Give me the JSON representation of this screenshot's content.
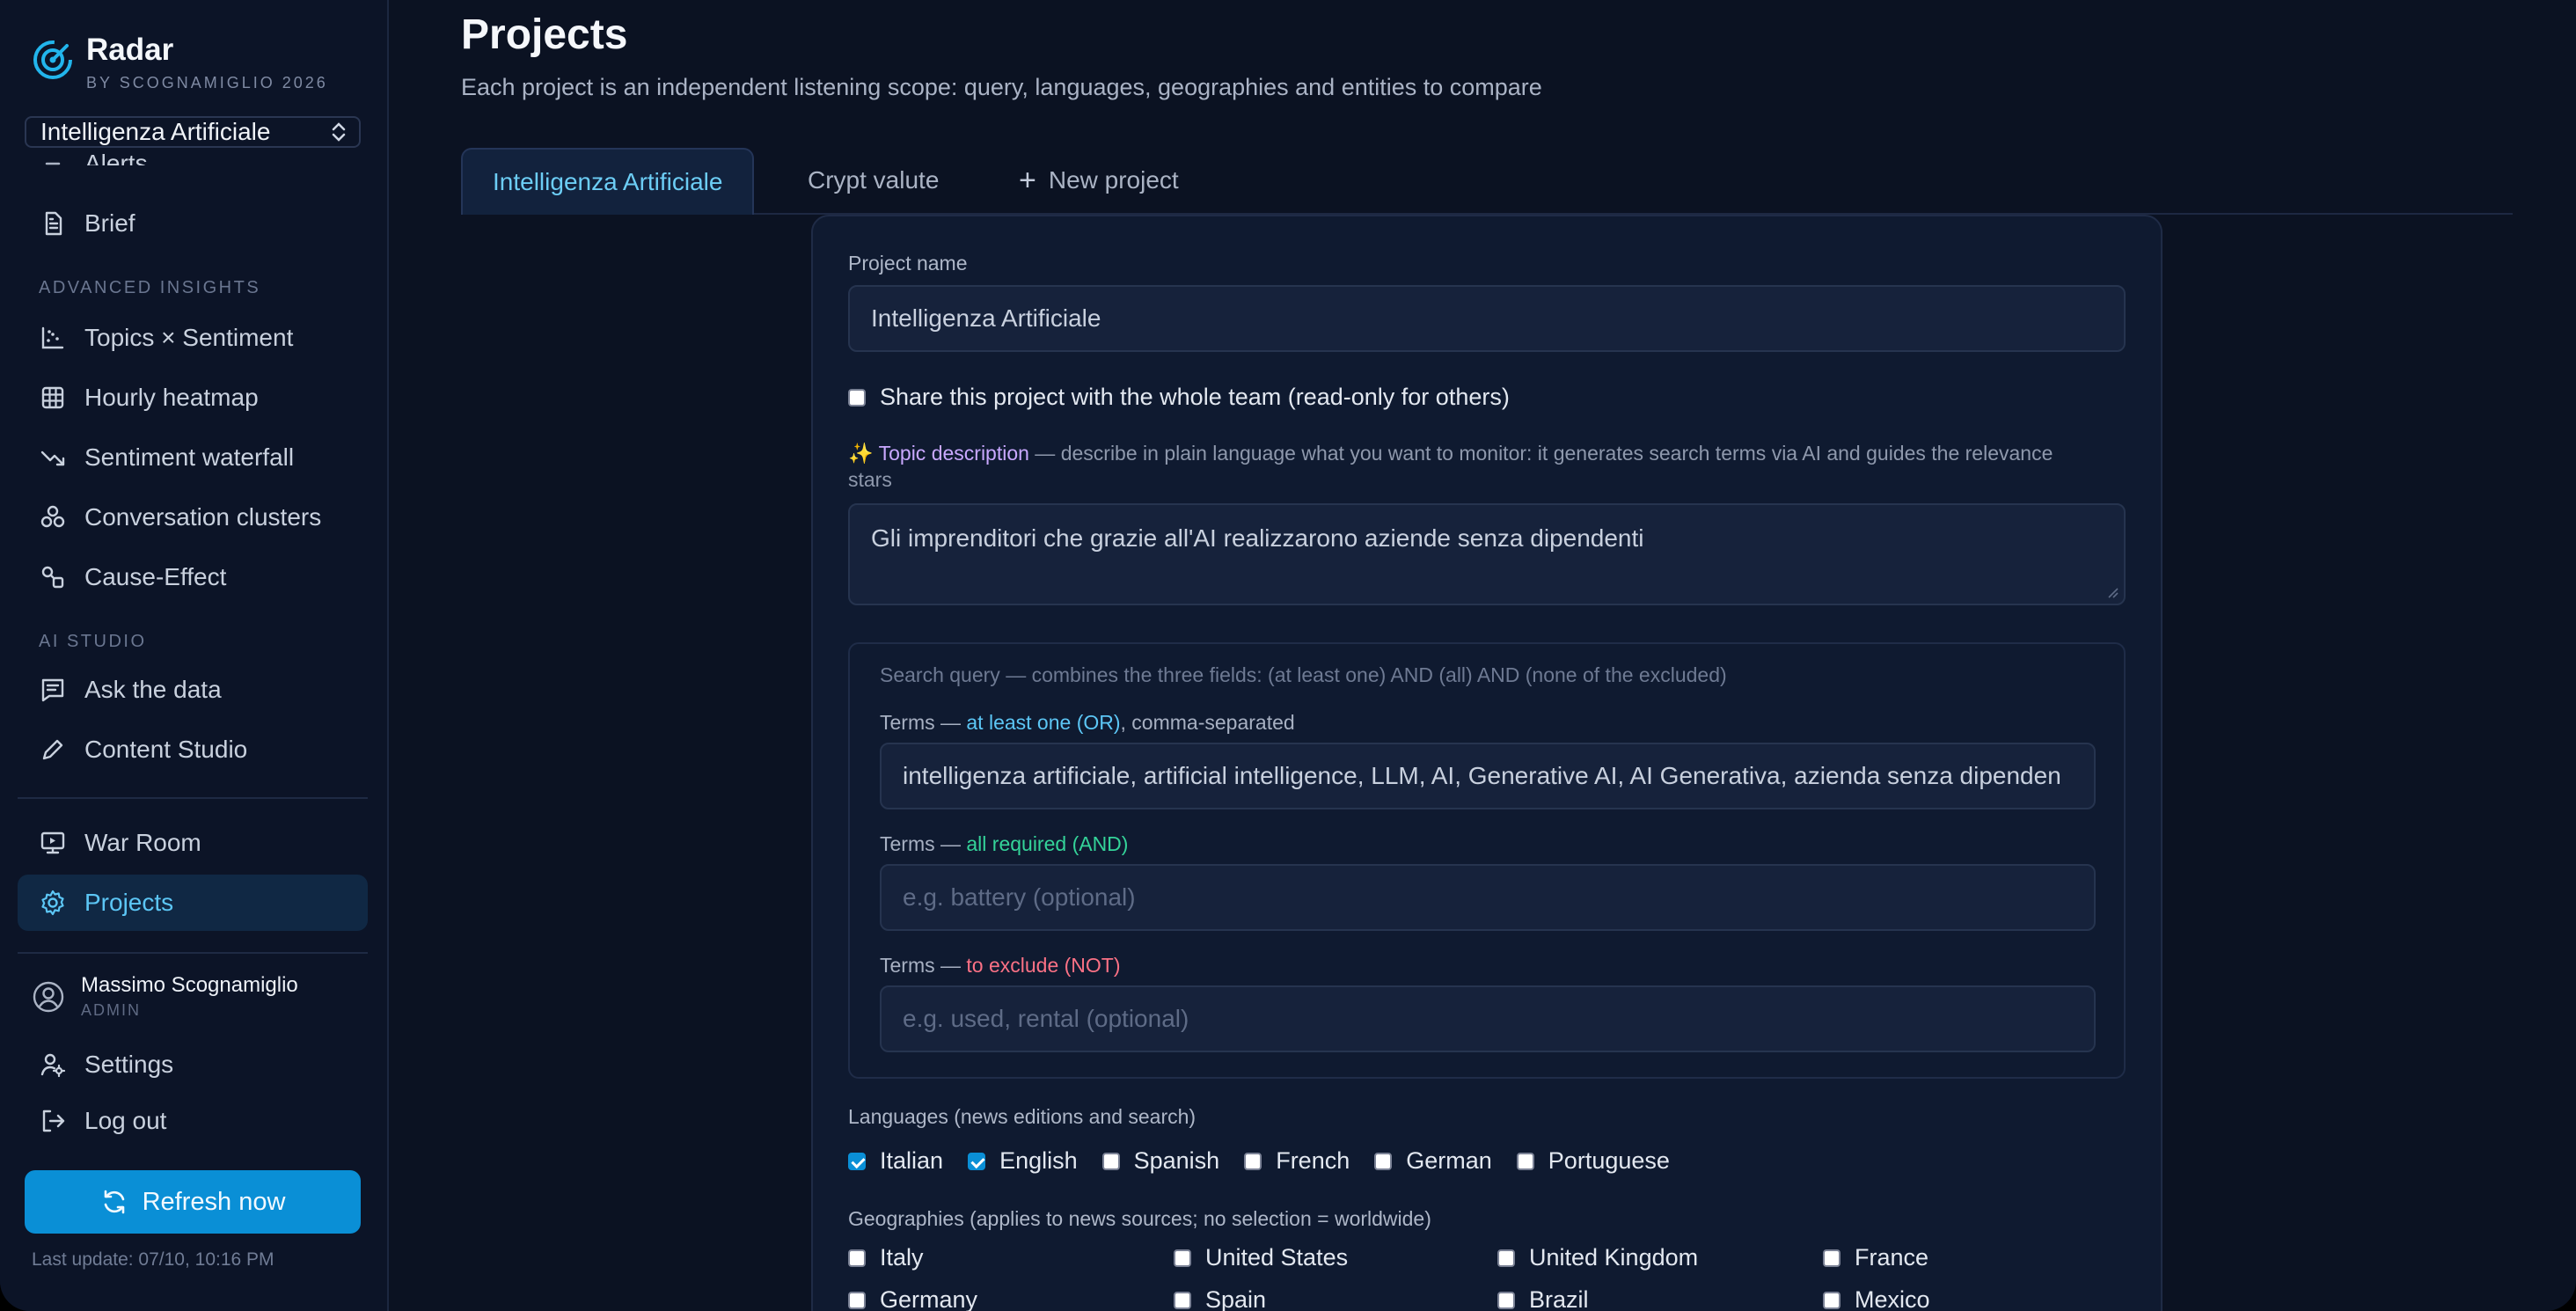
{
  "brand": {
    "name": "Radar",
    "subtitle": "BY SCOGNAMIGLIO 2026"
  },
  "project_selector": {
    "value": "Intelligenza Artificiale"
  },
  "sidebar": {
    "items_top": [
      {
        "label": "Alerts",
        "icon": "alerts-icon"
      },
      {
        "label": "Brief",
        "icon": "document-icon"
      }
    ],
    "section_advanced": "ADVANCED INSIGHTS",
    "items_advanced": [
      {
        "label": "Topics × Sentiment",
        "icon": "scatter-icon"
      },
      {
        "label": "Hourly heatmap",
        "icon": "grid-icon"
      },
      {
        "label": "Sentiment waterfall",
        "icon": "trend-down-icon"
      },
      {
        "label": "Conversation clusters",
        "icon": "clusters-icon"
      },
      {
        "label": "Cause-Effect",
        "icon": "cause-effect-icon"
      }
    ],
    "section_ai": "AI STUDIO",
    "items_ai": [
      {
        "label": "Ask the data",
        "icon": "chat-icon"
      },
      {
        "label": "Content Studio",
        "icon": "pen-icon"
      }
    ],
    "items_bottom": [
      {
        "label": "War Room",
        "icon": "monitor-icon"
      },
      {
        "label": "Projects",
        "icon": "gear-icon",
        "active": true
      }
    ],
    "user": {
      "name": "Massimo Scognamiglio",
      "role": "ADMIN"
    },
    "settings_label": "Settings",
    "logout_label": "Log out",
    "refresh_label": "Refresh now",
    "last_update": "Last update: 07/10, 10:16 PM"
  },
  "main": {
    "title": "Projects",
    "subtitle": "Each project is an independent listening scope: query, languages, geographies and entities to compare",
    "tabs": [
      {
        "label": "Intelligenza Artificiale",
        "active": true
      },
      {
        "label": "Crypt valute"
      },
      {
        "label": "New project"
      }
    ]
  },
  "form": {
    "name_label": "Project name",
    "name_value": "Intelligenza Artificiale",
    "share_label": "Share this project with the whole team (read-only for others)",
    "share_checked": false,
    "topic_label_accent": "✨ Topic description",
    "topic_label_rest": " — describe in plain language what you want to monitor: it generates search terms via AI and guides the relevance stars",
    "topic_value": "Gli imprenditori che grazie all'AI realizzarono aziende senza dipendenti",
    "query_heading": "Search query — combines the three fields: (at least one) AND (all) AND (none of the excluded)",
    "or_prefix": "Terms — ",
    "or_accent": "at least one (OR)",
    "or_suffix": ", comma-separated",
    "or_value": "intelligenza artificiale, artificial intelligence, LLM, AI, Generative AI, AI Generativa, azienda senza dipenden",
    "and_prefix": "Terms — ",
    "and_accent": "all required (AND)",
    "and_placeholder": "e.g. battery (optional)",
    "not_prefix": "Terms — ",
    "not_accent": "to exclude (NOT)",
    "not_placeholder": "e.g. used, rental (optional)",
    "languages_label": "Languages (news editions and search)",
    "languages": [
      {
        "label": "Italian",
        "checked": true
      },
      {
        "label": "English",
        "checked": true
      },
      {
        "label": "Spanish",
        "checked": false
      },
      {
        "label": "French",
        "checked": false
      },
      {
        "label": "German",
        "checked": false
      },
      {
        "label": "Portuguese",
        "checked": false
      }
    ],
    "geographies_label": "Geographies (applies to news sources; no selection = worldwide)",
    "geographies": [
      {
        "label": "Italy",
        "checked": false
      },
      {
        "label": "United States",
        "checked": false
      },
      {
        "label": "United Kingdom",
        "checked": false
      },
      {
        "label": "France",
        "checked": false
      },
      {
        "label": "Germany",
        "checked": false
      },
      {
        "label": "Spain",
        "checked": false
      },
      {
        "label": "Brazil",
        "checked": false
      },
      {
        "label": "Mexico",
        "checked": false
      }
    ]
  },
  "colors": {
    "accent": "#0a8fd6",
    "background": "#0b1222",
    "active_tab_text": "#6ccdf5"
  }
}
